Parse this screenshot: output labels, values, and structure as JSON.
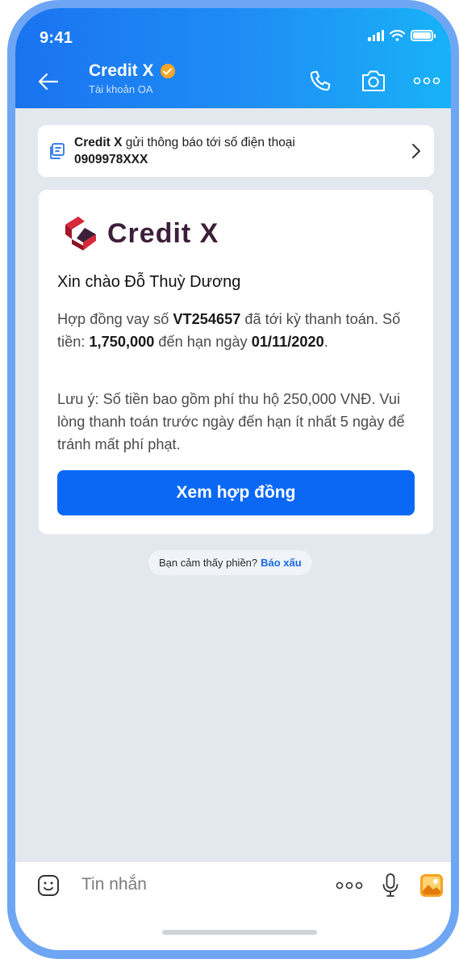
{
  "status_bar": {
    "time": "9:41"
  },
  "header": {
    "title": "Credit X",
    "subtitle": "Tài khoản OA"
  },
  "notice": {
    "sender": "Credit X",
    "text": " gửi thông báo tới số điện thoại",
    "phone": "0909978XXX"
  },
  "message": {
    "brand_name": "Credit X",
    "greeting": "Xin chào Đỗ Thuỳ Dương",
    "p1_a": "Hợp đồng vay số ",
    "contract_no": "VT254657",
    "p1_b": " đã tới kỳ thanh toán. Số tiền: ",
    "amount": "1,750,000",
    "p1_c": " đến hạn ngày ",
    "due_date": "01/11/2020",
    "p1_d": ".",
    "p2": "Lưu ý: Số tiền bao gồm phí thu hộ 250,000 VNĐ. Vui lòng thanh toán trước ngày đến hạn ít nhất 5 ngày để tránh mất phí phạt.",
    "button_label": "Xem hợp đồng"
  },
  "report": {
    "prompt": "Bạn cảm thấy phiền?",
    "link": "Báo xấu"
  },
  "composer": {
    "placeholder": "Tin nhắn"
  },
  "colors": {
    "header_gradient_start": "#1a73f0",
    "header_gradient_end": "#18b2f7",
    "primary_button": "#0a68f5",
    "chat_background": "#e3e8ef",
    "brand_dark": "#3d1f3b",
    "brand_red": "#d6293a",
    "verified_badge": "#f6a623",
    "device_frame": "#6ea6f4"
  },
  "icons": {
    "back": "arrow-left-icon",
    "verified": "verified-check-icon",
    "call": "phone-icon",
    "camera": "camera-icon",
    "more": "more-dots-icon",
    "notice": "notification-card-icon",
    "chevron": "chevron-right-icon",
    "sticker": "sticker-face-icon",
    "mic": "microphone-icon",
    "gallery": "gallery-image-icon"
  }
}
